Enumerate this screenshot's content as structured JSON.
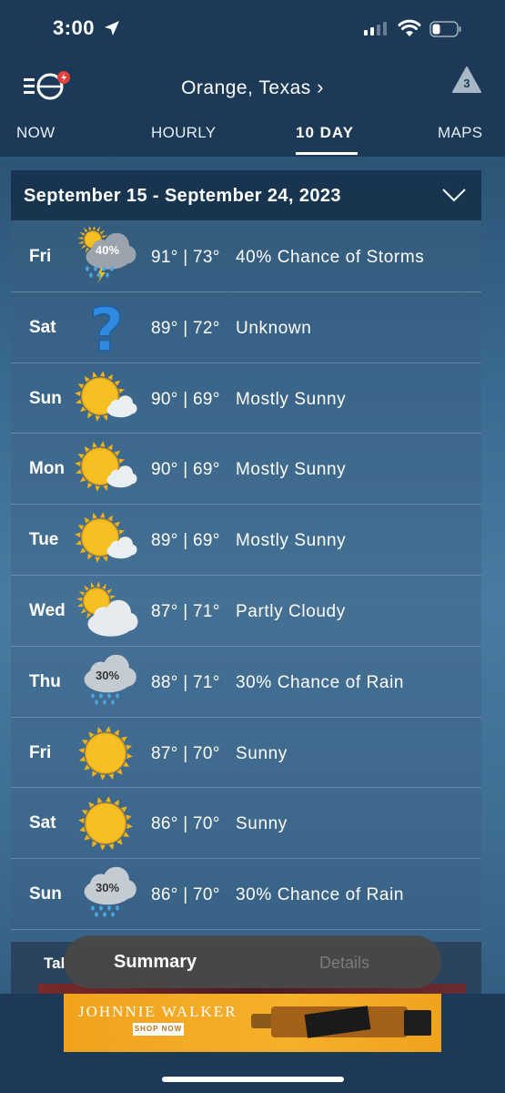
{
  "status_bar": {
    "time": "3:00"
  },
  "header": {
    "location": "Orange, Texas",
    "alert_count": "3"
  },
  "tabs": [
    {
      "label": "NOW"
    },
    {
      "label": "HOURLY"
    },
    {
      "label": "10 DAY"
    },
    {
      "label": "MAPS"
    }
  ],
  "forecast": {
    "date_range": "September 15 - September 24, 2023",
    "days": [
      {
        "day": "Fri",
        "temps": "91° | 73°",
        "condition": "40% Chance of Storms",
        "icon": "storm-cloud-icon",
        "badge": "40%"
      },
      {
        "day": "Sat",
        "temps": "89° | 72°",
        "condition": "Unknown",
        "icon": "question-mark-icon",
        "badge": ""
      },
      {
        "day": "Sun",
        "temps": "90° | 69°",
        "condition": "Mostly Sunny",
        "icon": "mostly-sunny-icon",
        "badge": ""
      },
      {
        "day": "Mon",
        "temps": "90° | 69°",
        "condition": "Mostly Sunny",
        "icon": "mostly-sunny-icon",
        "badge": ""
      },
      {
        "day": "Tue",
        "temps": "89° | 69°",
        "condition": "Mostly Sunny",
        "icon": "mostly-sunny-icon",
        "badge": ""
      },
      {
        "day": "Wed",
        "temps": "87° | 71°",
        "condition": "Partly Cloudy",
        "icon": "partly-cloudy-icon",
        "badge": ""
      },
      {
        "day": "Thu",
        "temps": "88° | 71°",
        "condition": "30% Chance of Rain",
        "icon": "rain-cloud-icon",
        "badge": "30%"
      },
      {
        "day": "Fri",
        "temps": "87° | 70°",
        "condition": "Sunny",
        "icon": "sun-icon",
        "badge": ""
      },
      {
        "day": "Sat",
        "temps": "86° | 70°",
        "condition": "Sunny",
        "icon": "sun-icon",
        "badge": ""
      },
      {
        "day": "Sun",
        "temps": "86° | 70°",
        "condition": "30% Chance of Rain",
        "icon": "rain-cloud-icon",
        "badge": "30%"
      }
    ]
  },
  "bottom": {
    "peek_label": "Tal",
    "summary_label": "Summary",
    "details_label": "Details"
  },
  "ad": {
    "brand": "JOHNNIE WALKER",
    "cta": "SHOP NOW"
  },
  "colors": {
    "background_dark": "#1c3a57",
    "sun": "#f6b81c",
    "ad": "#f0a21c"
  }
}
